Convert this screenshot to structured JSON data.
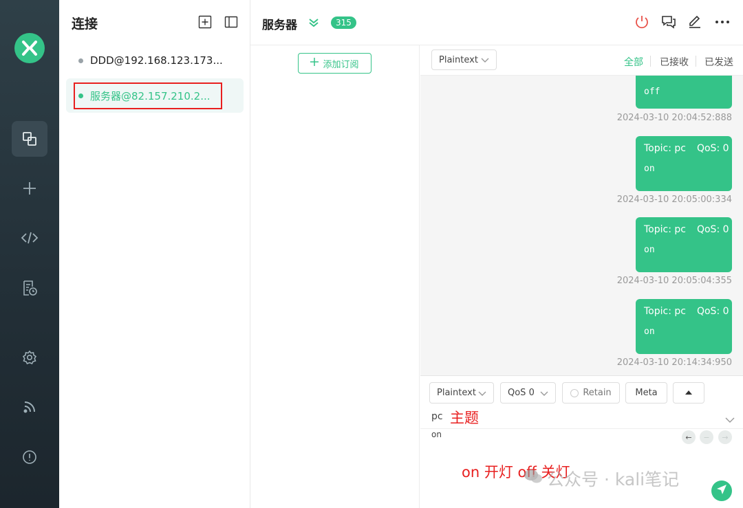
{
  "sidebar": {
    "items": [
      {
        "icon": "connections-icon",
        "active": true
      },
      {
        "icon": "plus-icon"
      },
      {
        "icon": "code-icon"
      },
      {
        "icon": "log-icon"
      },
      {
        "icon": "settings-icon"
      },
      {
        "icon": "feed-icon"
      },
      {
        "icon": "info-icon"
      }
    ]
  },
  "connections": {
    "title": "连接",
    "items": [
      {
        "label": "DDD@192.168.123.173...",
        "status_color": "#9aa3a8"
      },
      {
        "label": "服务器@82.157.210.2...",
        "status_color": "#34c388",
        "selected": true
      }
    ]
  },
  "header": {
    "title": "服务器",
    "count": "315"
  },
  "subscriptions": {
    "add_label": "添加订阅"
  },
  "messages": {
    "format": "Plaintext",
    "filters": [
      "全部",
      "已接收",
      "已发送"
    ],
    "list": [
      {
        "topic": "",
        "qos": "",
        "payload": "off",
        "time": "2024-03-10 20:04:52:888"
      },
      {
        "topic": "Topic: pc",
        "qos": "QoS: 0",
        "payload": "on",
        "time": "2024-03-10 20:05:00:334"
      },
      {
        "topic": "Topic: pc",
        "qos": "QoS: 0",
        "payload": "on",
        "time": "2024-03-10 20:05:04:355"
      },
      {
        "topic": "Topic: pc",
        "qos": "QoS: 0",
        "payload": "on",
        "time": "2024-03-10 20:14:34:950"
      }
    ]
  },
  "composer": {
    "format": "Plaintext",
    "qos": "QoS 0",
    "retain": "Retain",
    "meta": "Meta",
    "topic": "pc",
    "topic_note": "主题",
    "payload": "on",
    "overlay_note": "on 开灯   off 关灯",
    "watermark": "公众号 · kali笔记"
  },
  "colors": {
    "accent": "#34c388",
    "annotation": "#e81f1f",
    "rail": "#2a3840"
  }
}
